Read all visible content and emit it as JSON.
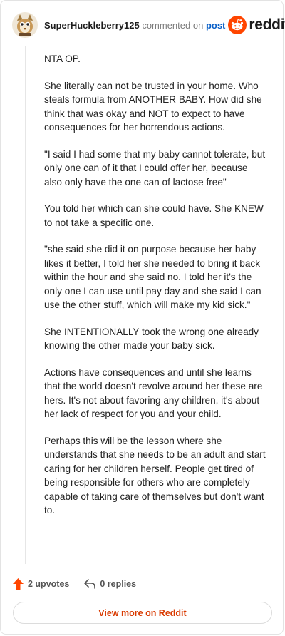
{
  "comment": {
    "username": "SuperHuckleberry125",
    "action_text": "commented on",
    "post_link": "post",
    "brand": "reddit",
    "paragraphs": [
      "NTA OP.",
      "She literally can not be trusted in your home. Who steals formula from ANOTHER BABY. How did she think that was okay and NOT to expect to have consequences for her horrendous actions.",
      "\"I said I had some that my baby cannot tolerate, but only one can of it that I could offer her, because also only have the one can of lactose free\"",
      "You told her which can she could have. She KNEW to not take a specific one.",
      "\"she said she did it on purpose because her baby likes it better, I told her she needed to bring it back within the hour and she said no. I told her it's the only one I can use until pay day and she said I can use the other stuff, which will make my kid sick.\"",
      "She INTENTIONALLY took the wrong one already knowing the other made your baby sick.",
      "Actions have consequences and until she learns that the world doesn't revolve around her these are hers. It's not about favoring any children, it's about her lack of respect for you and your child.",
      "Perhaps this will be the lesson where she understands that she needs to be an adult and start caring for her children herself. People get tired of being responsible for others who are completely capable of taking care of themselves but don't want to."
    ],
    "upvotes": "2 upvotes",
    "replies": "0 replies",
    "view_more": "View more on Reddit"
  },
  "colors": {
    "accent": "#ff4500",
    "link": "#0a60c8",
    "view_more_text": "#d93a00"
  },
  "icons": [
    "avatar-image",
    "reddit-snoo-icon",
    "upvote-arrow-icon",
    "reply-icon"
  ]
}
